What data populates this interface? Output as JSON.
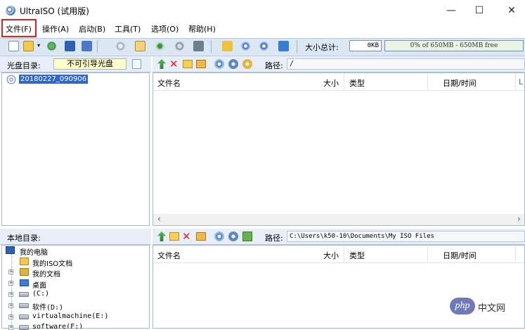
{
  "window": {
    "title": "UltraISO (试用版)",
    "minimize_glyph": "—",
    "maximize_glyph": "☐",
    "close_glyph": "✕"
  },
  "menu": [
    {
      "label": "文件(F)",
      "highlighted": true,
      "highlight_color": "#e4201b"
    },
    {
      "label": "操作(A)"
    },
    {
      "label": "启动(B)"
    },
    {
      "label": "工具(T)"
    },
    {
      "label": "选项(O)"
    },
    {
      "label": "帮助(H)"
    }
  ],
  "toolbar": {
    "icons": [
      "new-icon",
      "open-icon",
      "dropdown-icon",
      "extract-icon",
      "save-icon",
      "save-as-icon",
      "burn-icon",
      "mount-icon",
      "compress-icon",
      "virtual-drive-icon",
      "make-image-icon",
      "convert-icon",
      "info-icon",
      "help-icon",
      "exit-icon"
    ],
    "size_label": "大小总计:",
    "size_value": "0KB",
    "capacity_text": "0% of 650MB - 650MB free"
  },
  "disc_panel": {
    "label": "光盘目录:",
    "disc_type": "不可引导光盘",
    "root_item": "20180227_090906"
  },
  "upper_files": {
    "path_label": "路径:",
    "path": "/",
    "columns": [
      "文件名",
      "大小",
      "类型",
      "日期/时间",
      "L"
    ]
  },
  "local_panel": {
    "label": "本地目录:",
    "tree": [
      {
        "label": "我的电脑",
        "icon": "computer-icon"
      },
      {
        "label": "我的ISO文档",
        "icon": "disc-folder-icon"
      },
      {
        "label": "我的文档",
        "icon": "documents-icon"
      },
      {
        "label": "桌面",
        "icon": "desktop-icon"
      },
      {
        "label": "(C:)",
        "icon": "drive-icon"
      },
      {
        "label": "软件(D:)",
        "icon": "drive-icon"
      },
      {
        "label": "virtualmachine(E:)",
        "icon": "drive-icon"
      },
      {
        "label": "software(F:)",
        "icon": "drive-icon"
      }
    ]
  },
  "lower_files": {
    "path_label": "路径:",
    "path": "C:\\Users\\k50-10\\Documents\\My ISO Files",
    "columns": [
      "文件名",
      "大小",
      "类型",
      "日期/时间"
    ]
  },
  "watermark": {
    "logo": "php",
    "text": "中文网"
  }
}
